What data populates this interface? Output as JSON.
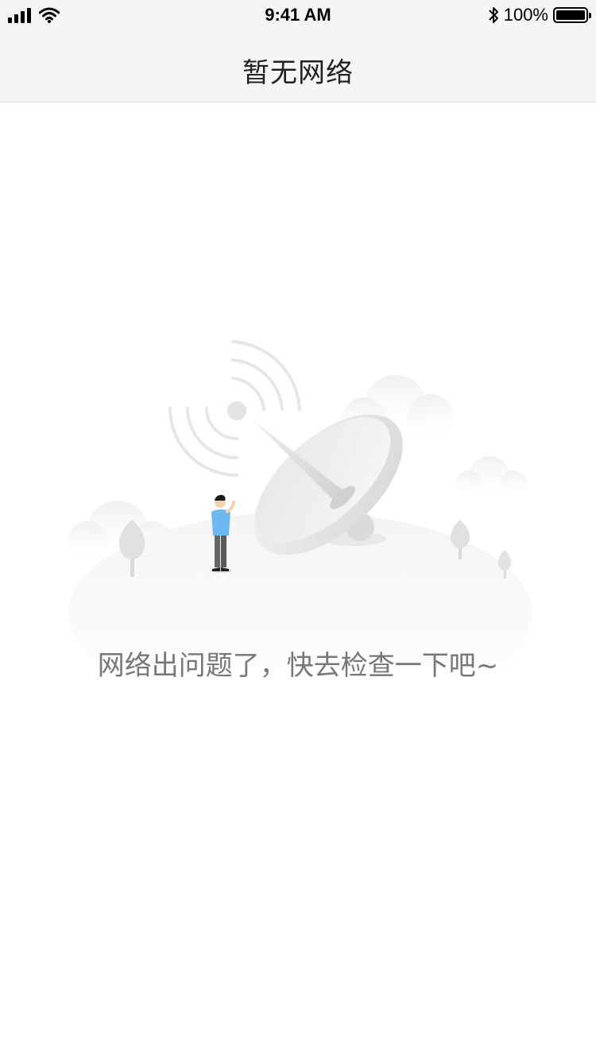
{
  "status_bar": {
    "time": "9:41 AM",
    "battery_percent": "100%",
    "icons": [
      "signal-icon",
      "wifi-icon",
      "bluetooth-icon",
      "battery-icon"
    ]
  },
  "nav": {
    "title": "暂无网络"
  },
  "empty_state": {
    "message": "网络出问题了，快去检查一下吧~",
    "illustration": "satellite-dish-illustration"
  },
  "colors": {
    "bar_background": "#f5f5f5",
    "message_text": "#777777",
    "person_shirt": "#6db8f5"
  }
}
